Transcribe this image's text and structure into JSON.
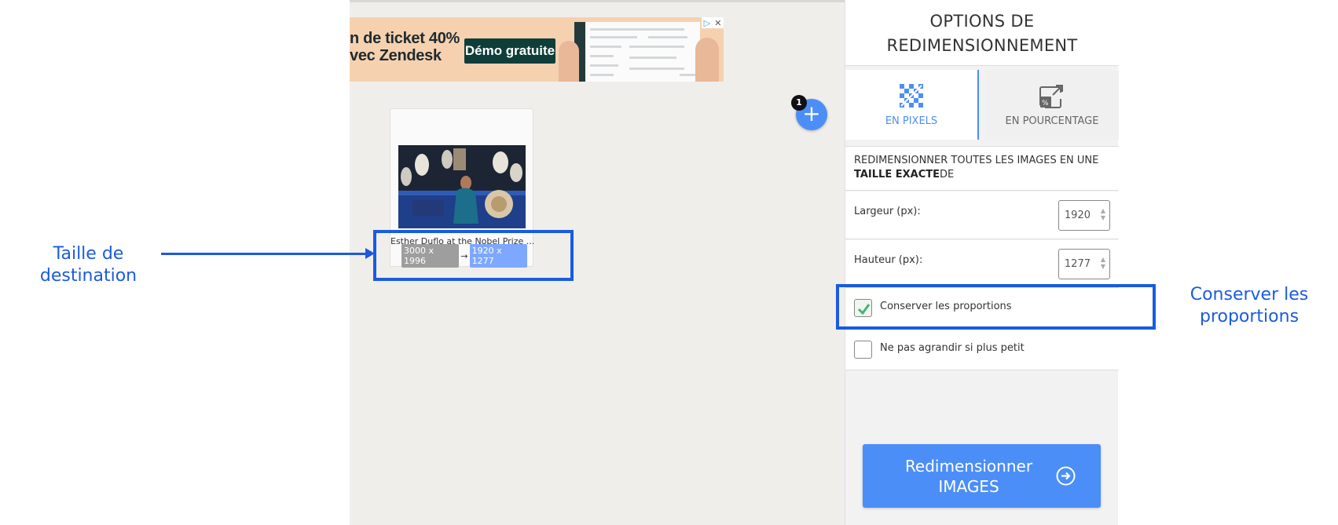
{
  "ad": {
    "line1": "n de ticket 40%",
    "line2": "vec Zendesk",
    "cta": "Démo gratuite",
    "controls": [
      "▷",
      "✕"
    ]
  },
  "image_card": {
    "name": "Esther Duflo at the Nobel Prize ...",
    "source_size": "3000 x 1996",
    "arrow": "→",
    "target_size": "1920 x 1277"
  },
  "add_button": {
    "label": "+",
    "badge_count": "1"
  },
  "panel": {
    "title_line1": "OPTIONS DE",
    "title_line2": "REDIMENSIONNEMENT",
    "tabs": [
      {
        "label": "EN PIXELS",
        "icon": "pixel-grid-icon",
        "active": true
      },
      {
        "label": "EN POURCENTAGE",
        "icon": "percent-resize-icon",
        "active": false
      }
    ],
    "description_prefix": "REDIMENSIONNER TOUTES LES IMAGES EN UNE ",
    "description_bold": "TAILLE EXACTE",
    "description_suffix": "DE",
    "width_label": "Largeur (px):",
    "width_value": "1920",
    "height_label": "Hauteur (px):",
    "height_value": "1277",
    "keep_ratio_label": "Conserver les proportions",
    "keep_ratio_checked": true,
    "no_enlarge_label": "Ne pas agrandir si plus petit",
    "no_enlarge_checked": false,
    "submit_line1": "Redimensionner",
    "submit_line2": "IMAGES"
  },
  "annotations": {
    "left_line1": "Taille de",
    "left_line2": "destination",
    "right_line1": "Conserver les",
    "right_line2": "proportions"
  },
  "colors": {
    "accent": "#4c8ef7",
    "annotation": "#1a5be0",
    "workspace": "#f0eeeb"
  }
}
